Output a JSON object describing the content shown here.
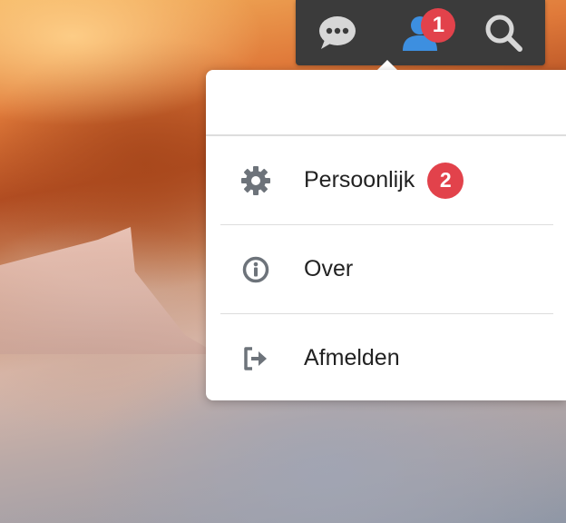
{
  "topbar": {
    "buttons": [
      {
        "icon": "chat-icon"
      },
      {
        "icon": "contacts-icon",
        "badge": "1"
      },
      {
        "icon": "search-icon"
      }
    ]
  },
  "menu": {
    "items": [
      {
        "icon": "gear-icon",
        "label": "Persoonlijk",
        "badge": "2"
      },
      {
        "icon": "info-icon",
        "label": "Over"
      },
      {
        "icon": "logout-icon",
        "label": "Afmelden"
      }
    ]
  },
  "colors": {
    "topbar": "#3b3b3b",
    "badge": "#e2424b",
    "accent_blue": "#3d8fe0",
    "icon_gray": "#6d737a"
  }
}
